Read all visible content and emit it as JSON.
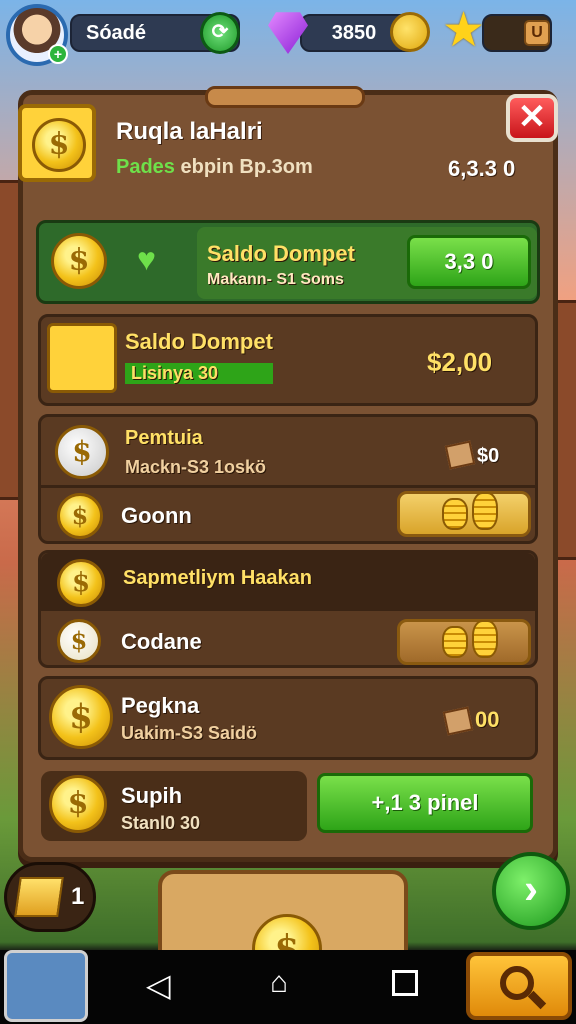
{
  "topbar": {
    "player_name": "Sóadé",
    "currency": "3850",
    "star_button": "U"
  },
  "dialog": {
    "title": "Ruqla laHalri",
    "subtitle_green": "Pades",
    "subtitle_rest": " ebpin Bp.3om",
    "header_value": "6,3.3 0",
    "close_label": "✕"
  },
  "rows": [
    {
      "title": "Saldo Dompet",
      "subtitle": "Makann- S1 Soms",
      "button": "3,3 0"
    },
    {
      "title": "Saldo Dompet",
      "subtitle": "Lisinya 30",
      "value": "$2,00"
    },
    {
      "title": "Pemtuia",
      "subtitle": "Mackn-S3 1oskö",
      "value": "$0",
      "sub_label": "Goonn"
    },
    {
      "title": "Sapmetliym Haakan",
      "sub_label": "Codane"
    },
    {
      "title": "Pegkna",
      "subtitle": "Uakim-S3 Saidö",
      "value": "00"
    },
    {
      "title": "Supih",
      "subtitle": "Stanl0 30",
      "button": "+,1 3 pinel"
    }
  ],
  "bottom": {
    "counter": "1",
    "next_label": "›"
  },
  "icons": [
    "avatar",
    "plus-icon",
    "gem-icon",
    "coin-icon",
    "star-icon",
    "close-icon",
    "heart-icon",
    "chest-icon",
    "back-icon",
    "home-icon",
    "recent-icon",
    "search-icon"
  ],
  "colors": {
    "accent_green": "#2ea418",
    "gold": "#f3c21a",
    "panel": "#7b5233",
    "close_red": "#c8141a"
  }
}
